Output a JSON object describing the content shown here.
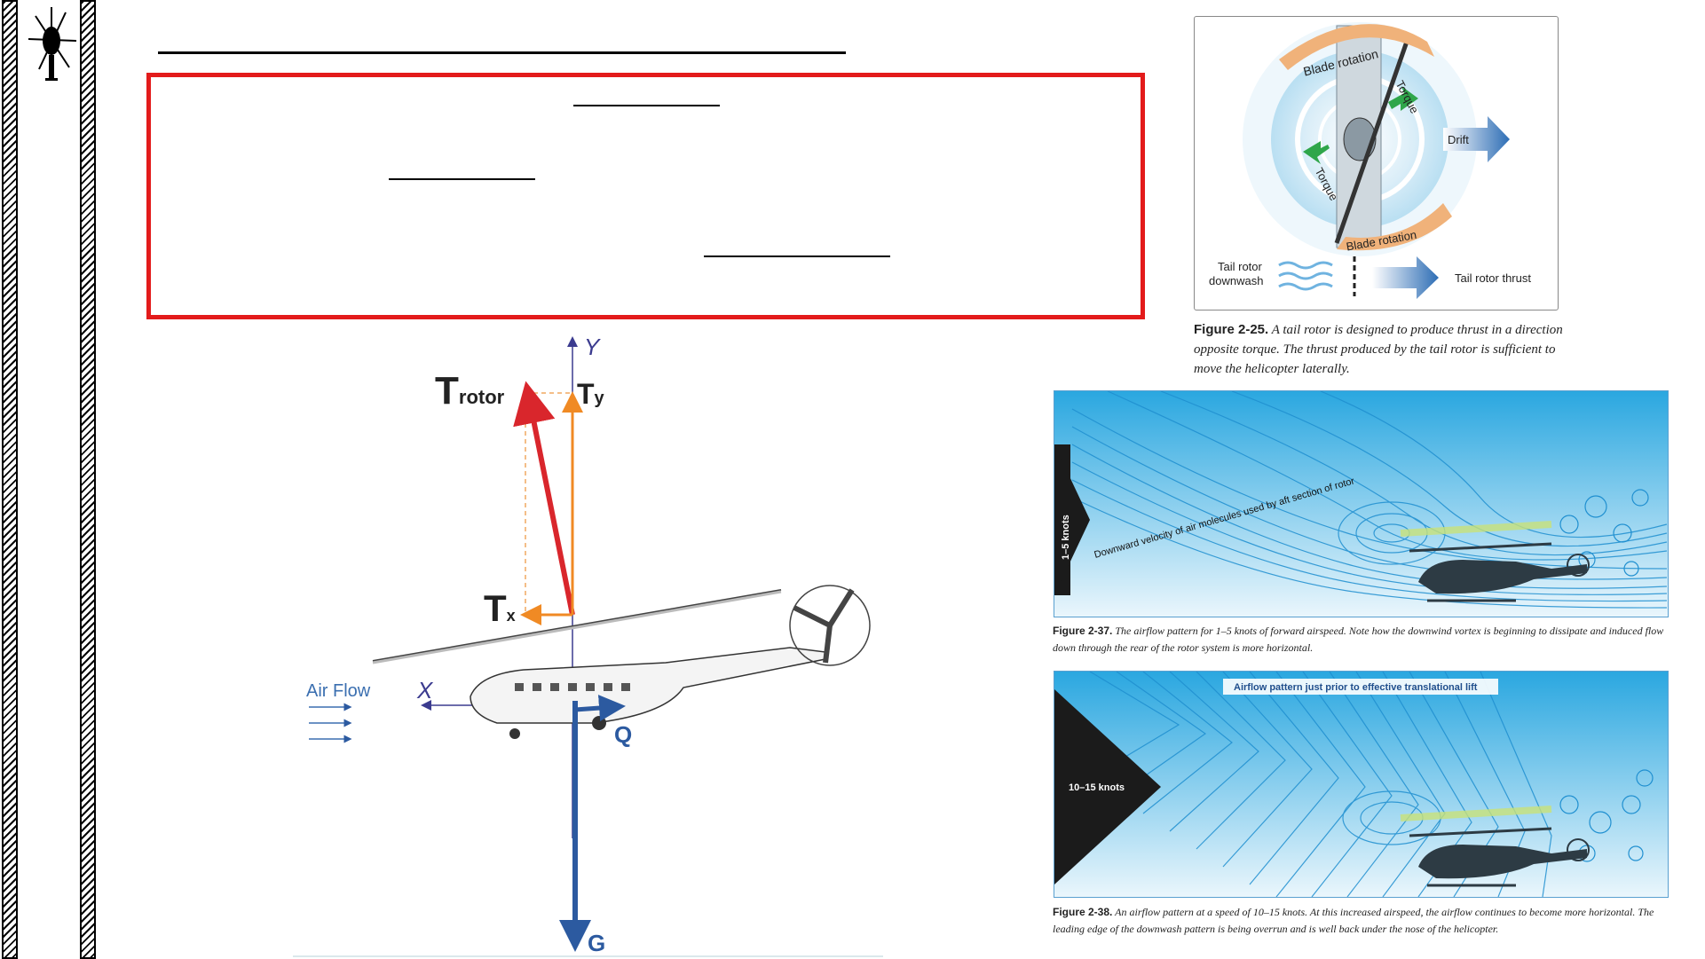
{
  "figure_2_25": {
    "labels": {
      "blade_rotation_top": "Blade rotation",
      "blade_rotation_bottom": "Blade rotation",
      "torque_top": "Torque",
      "torque_bottom": "Torque",
      "drift": "Drift",
      "tail_rotor_downwash_1": "Tail rotor",
      "tail_rotor_downwash_2": "downwash",
      "tail_rotor_thrust": "Tail rotor thrust"
    },
    "caption_num": "Figure 2-25.",
    "caption_text": "A tail rotor is designed to produce thrust in a direction opposite torque. The thrust produced by the tail rotor is sufficient to move the helicopter laterally."
  },
  "figure_2_37": {
    "speed_label": "1–5 knots",
    "flow_label": "Downward velocity of air molecules used by aft section of rotor",
    "caption_num": "Figure 2-37.",
    "caption_text": "The airflow pattern for 1–5 knots of forward airspeed. Note how the downwind vortex is beginning to dissipate and induced flow down through the rear of the rotor system is more horizontal."
  },
  "figure_2_38": {
    "speed_label": "10–15 knots",
    "banner": "Airflow pattern just prior to effective translational lift",
    "caption_num": "Figure 2-38.",
    "caption_text": "An airflow pattern at a speed of 10–15 knots. At this increased airspeed, the airflow continues to become more horizontal. The leading edge of the downwash pattern is being overrun and is well back under the nose of the helicopter."
  },
  "force_diagram": {
    "t_rotor_main": "T",
    "t_rotor_sub": "rotor",
    "ty_main": "T",
    "ty_sub": "y",
    "tx_main": "T",
    "tx_sub": "x",
    "axis_y": "Y",
    "axis_x": "X",
    "q": "Q",
    "g": "G",
    "air_flow": "Air Flow"
  },
  "colors": {
    "box_border": "#e31b1b",
    "t_rotor_arrow": "#d9262c",
    "ty_arrow": "#f08a24",
    "g_arrow": "#2c5aa0",
    "axis": "#3b3b8f",
    "flow_bg": "#2aa7e0"
  }
}
